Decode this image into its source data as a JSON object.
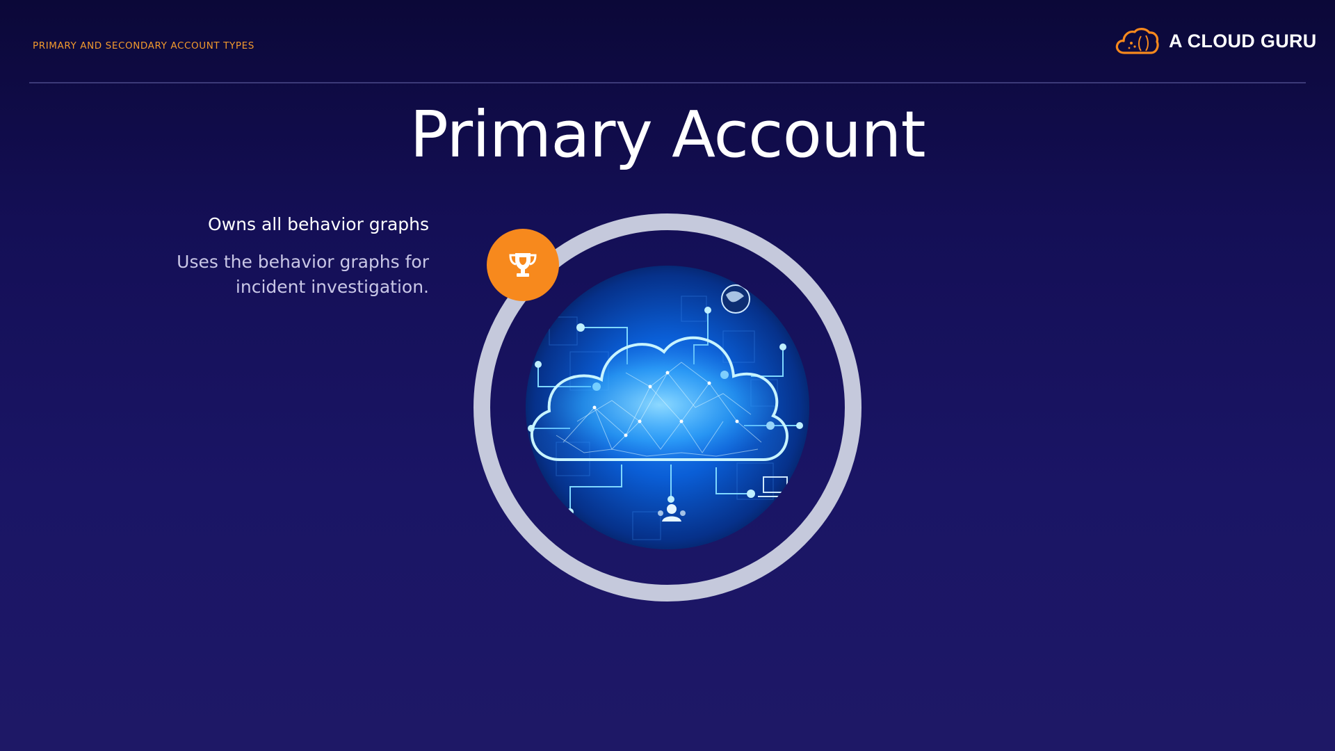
{
  "header": {
    "breadcrumb": "PRIMARY AND SECONDARY ACCOUNT TYPES",
    "logo_text": "A CLOUD GURU"
  },
  "slide": {
    "title": "Primary Account",
    "point_heading": "Owns all behavior graphs",
    "point_body_line1": "Uses the behavior graphs for",
    "point_body_line2": "incident investigation."
  },
  "icons": {
    "logo": "cloud-logo-icon",
    "badge": "trophy-icon",
    "illustration": "cloud-network-illustration"
  },
  "colors": {
    "background": "#140f56",
    "accent_orange": "#f7891d",
    "ring": "#c5c9dc",
    "illustration_blue": "#0a4fb8"
  }
}
